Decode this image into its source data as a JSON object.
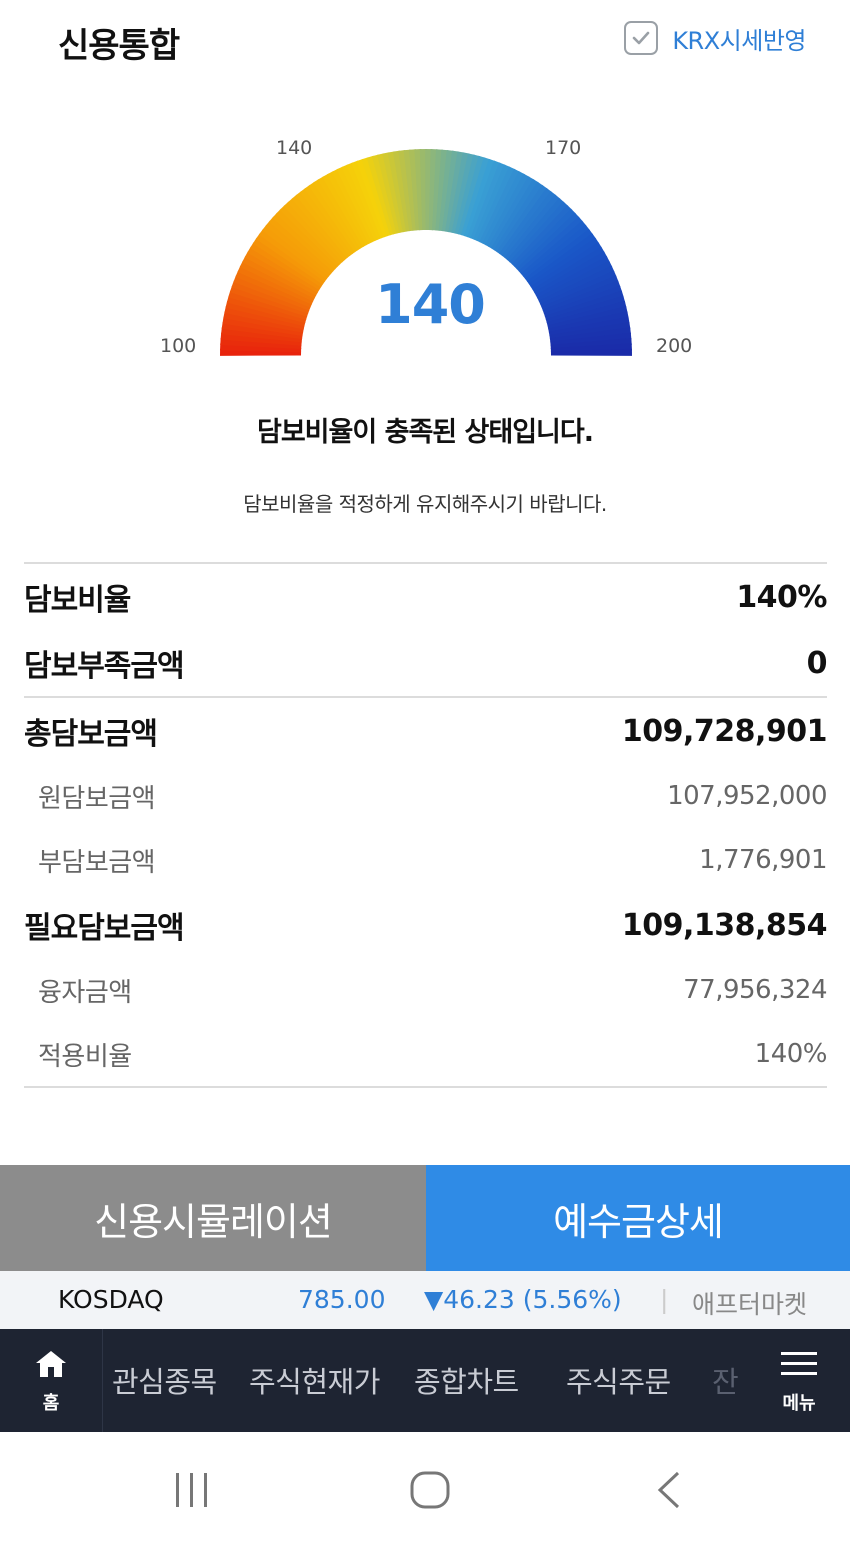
{
  "header": {
    "title": "신용통합",
    "krx_label": "KRX시세반영",
    "krx_checked": true
  },
  "gauge": {
    "value": "140",
    "ticks": {
      "min": "100",
      "low": "140",
      "high": "170",
      "max": "200"
    },
    "colors": [
      "#e8200c",
      "#f59a08",
      "#f5d20a",
      "#3aa0d4",
      "#1a58c8",
      "#1a2aa8"
    ]
  },
  "status": {
    "title": "담보비율이 충족된 상태입니다.",
    "subtitle": "담보비율을 적정하게 유지해주시기 바랍니다."
  },
  "summary": {
    "ratio": {
      "label": "담보비율",
      "value": "140%"
    },
    "shortfall": {
      "label": "담보부족금액",
      "value": "0"
    },
    "total": {
      "label": "총담보금액",
      "value": "109,728,901"
    },
    "original": {
      "label": "원담보금액",
      "value": "107,952,000"
    },
    "secondary": {
      "label": "부담보금액",
      "value": "1,776,901"
    },
    "required": {
      "label": "필요담보금액",
      "value": "109,138,854"
    },
    "loan": {
      "label": "융자금액",
      "value": "77,956,324"
    },
    "applied": {
      "label": "적용비율",
      "value": "140%"
    }
  },
  "buttons": {
    "simulation": "신용시뮬레이션",
    "deposit_detail": "예수금상세"
  },
  "ticker": {
    "name": "KOSDAQ",
    "price": "785.00",
    "change": "▼46.23 (5.56%)",
    "separator": "|",
    "after_market": "애프터마켓"
  },
  "tabbar": {
    "home": "홈",
    "items": [
      "관심종목",
      "주식현재가",
      "종합차트",
      "주식주문",
      "잔"
    ],
    "menu": "메뉴"
  }
}
